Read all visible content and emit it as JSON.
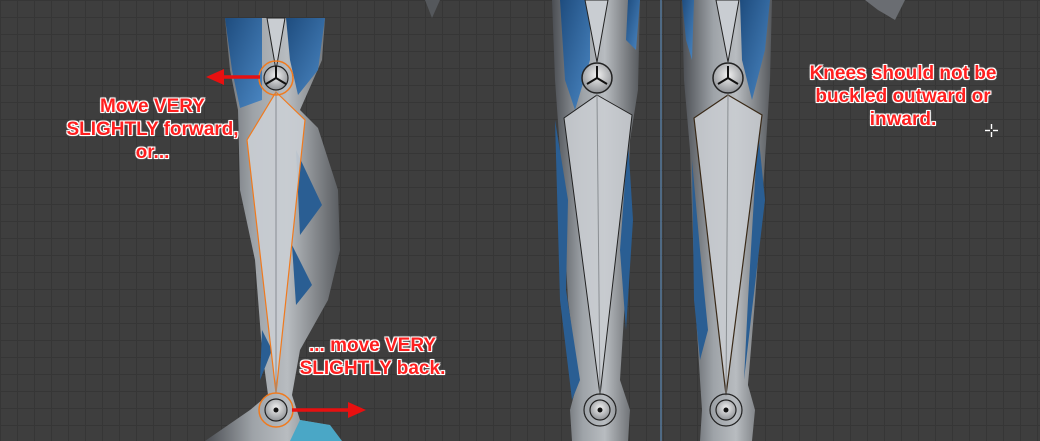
{
  "annotations": {
    "left_top": [
      "Move VERY",
      "SLIGHTLY forward,",
      "or..."
    ],
    "left_bottom": [
      "... move VERY",
      "SLIGHTLY back."
    ],
    "right": [
      "Knees should not be",
      "buckled outward or",
      "inward."
    ]
  },
  "colors": {
    "annotation_text": "#ff1f1f",
    "arrow": "#e81010",
    "selected_joint": "#f07a1e",
    "bone": "#c9cdd2",
    "armor_blue": "#2a5e93",
    "grid": "#363636"
  },
  "icons": {
    "viewport_cursor": "crosshair-cursor-icon",
    "joint": "bone-joint-icon"
  }
}
